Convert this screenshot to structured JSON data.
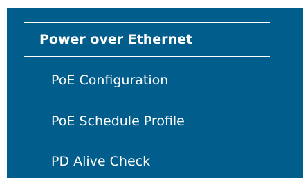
{
  "sidebar": {
    "section_title": "Power over Ethernet",
    "items": [
      {
        "label": "PoE Configuration"
      },
      {
        "label": "PoE Schedule Profile"
      },
      {
        "label": "PD Alive Check"
      }
    ]
  },
  "colors": {
    "panel_background": "#005d8c",
    "text": "#ffffff",
    "page_background": "#ffffff"
  }
}
